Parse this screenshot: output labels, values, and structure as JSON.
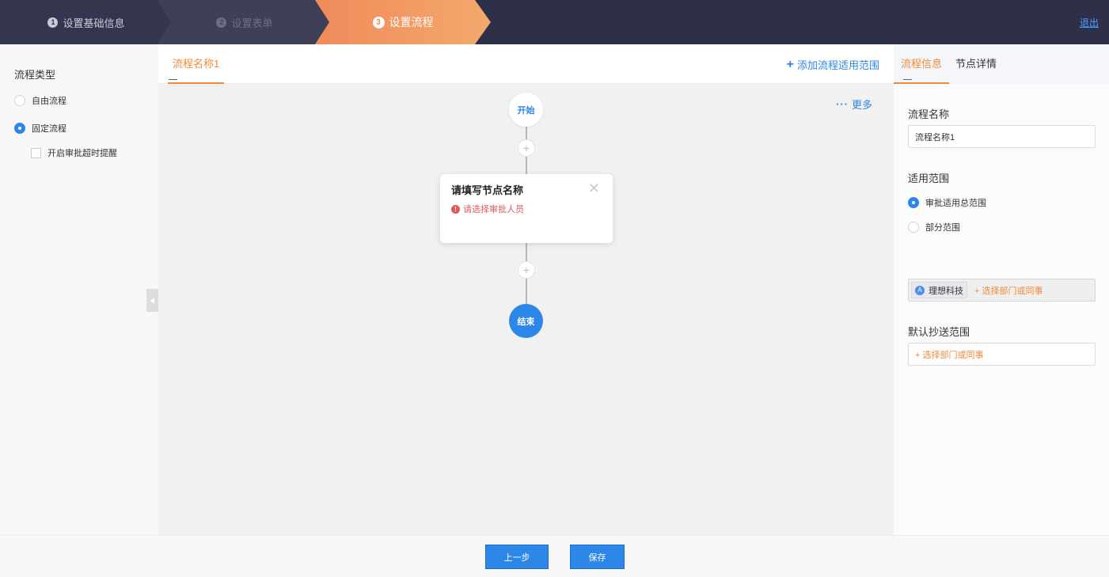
{
  "header": {
    "steps": [
      {
        "num": "1",
        "label": "设置基础信息"
      },
      {
        "num": "2",
        "label": "设置表单"
      },
      {
        "num": "3",
        "label": "设置流程"
      }
    ],
    "logout_label": "退出"
  },
  "left_panel": {
    "title": "流程类型",
    "options": [
      {
        "label": "自由流程",
        "selected": false
      },
      {
        "label": "固定流程",
        "selected": true
      }
    ],
    "timeout_reminder_label": "开启审批超时提醒",
    "timeout_reminder_checked": false
  },
  "center": {
    "flow_tab_label": "流程名称1",
    "add_scope_plus": "+",
    "add_scope_label": "添加流程适用范围",
    "more_dots": "···",
    "more_label": "更多",
    "start_label": "开始",
    "end_label": "结束",
    "add_node_symbol": "+",
    "node": {
      "title": "请填写节点名称",
      "close_symbol": "✕",
      "warning_icon": "!",
      "warning": "请选择审批人员"
    }
  },
  "right_panel": {
    "tabs": [
      {
        "label": "流程信息",
        "active": true
      },
      {
        "label": "节点详情",
        "active": false
      }
    ],
    "flow_name_label": "流程名称",
    "flow_name_value": "流程名称1",
    "scope_label": "适用范围",
    "scope_options": [
      {
        "label": "审批适用总范围",
        "selected": true
      },
      {
        "label": "部分范围",
        "selected": false
      }
    ],
    "scope_tag_icon": "A",
    "scope_tag": "理想科技",
    "scope_add_label": "+ 选择部门或同事",
    "cc_label": "默认抄送范围",
    "cc_add_label": "+ 选择部门或同事"
  },
  "footer": {
    "prev_label": "上一步",
    "save_label": "保存"
  },
  "colors": {
    "accent_orange": "#f08a3c",
    "primary_blue": "#2c87e8",
    "header_bg": "#2e3049",
    "error_red": "#e0585a"
  }
}
